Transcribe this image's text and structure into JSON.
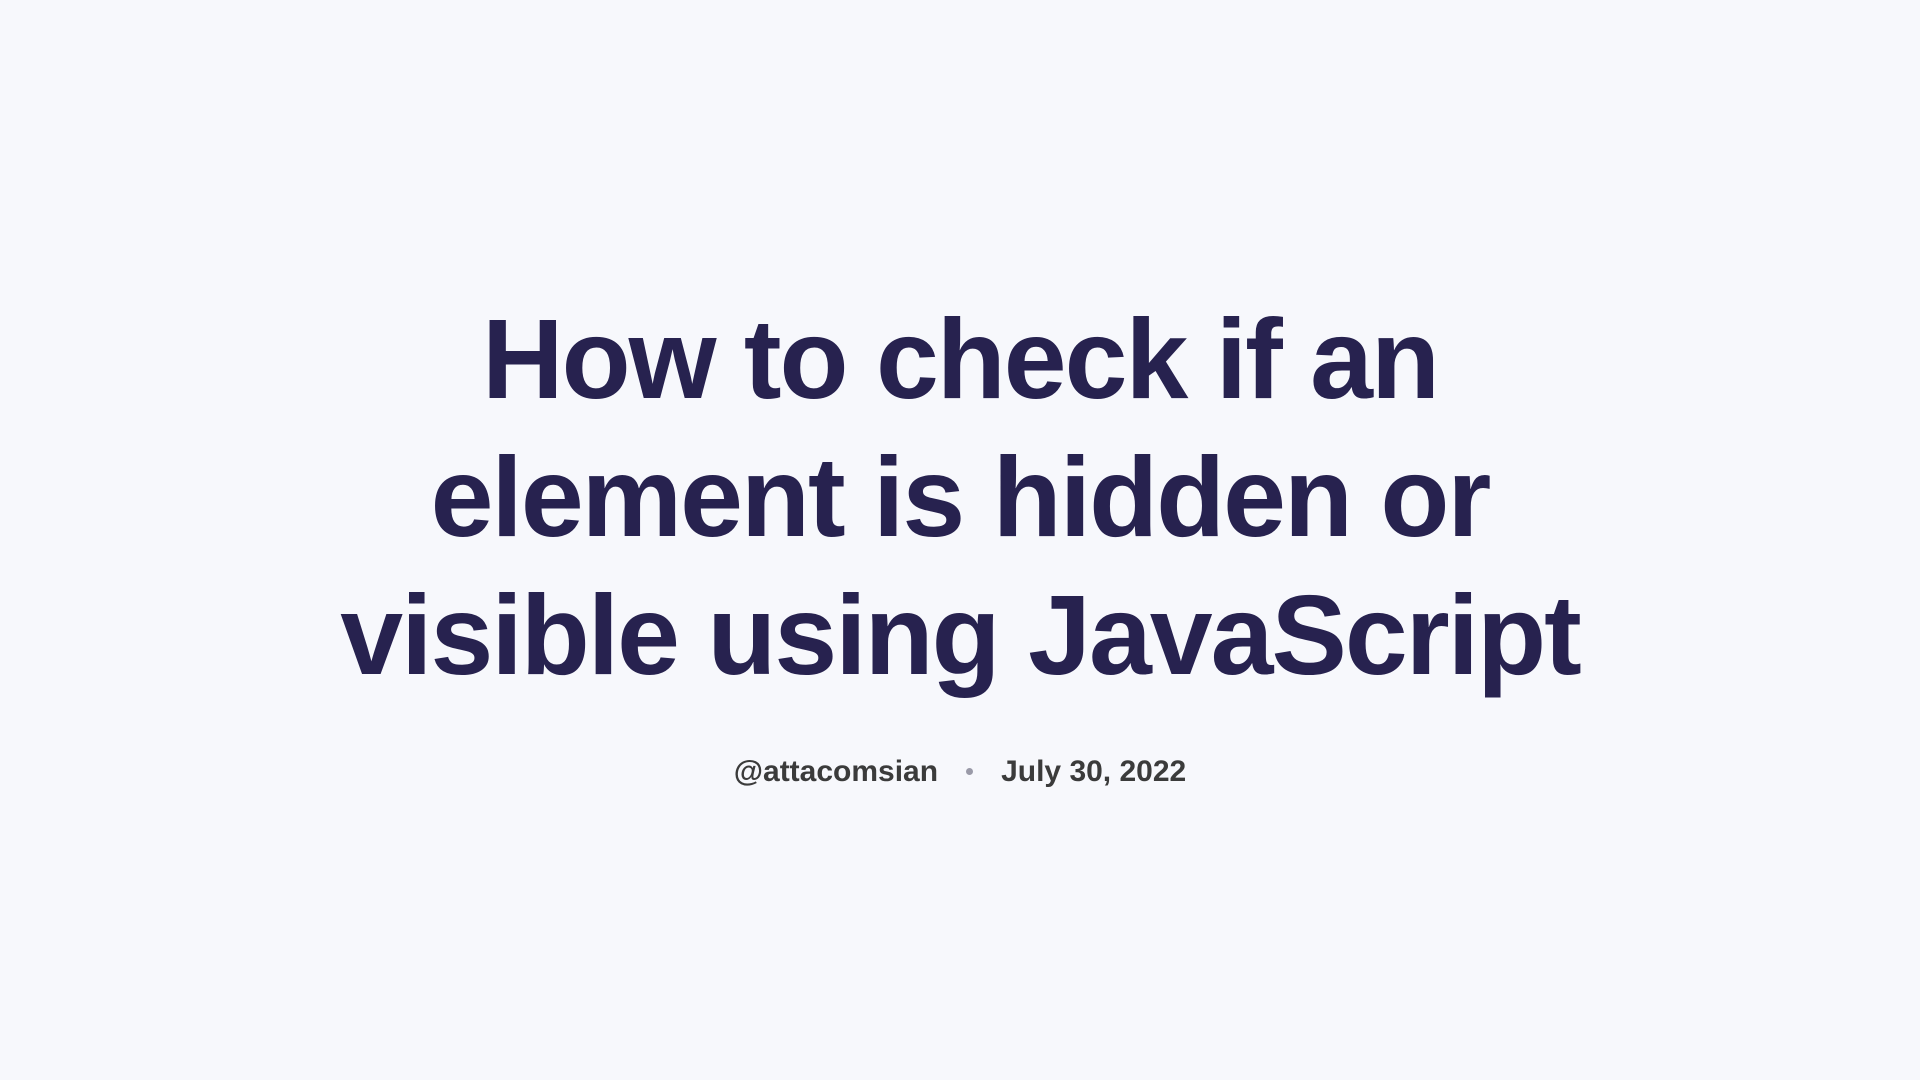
{
  "article": {
    "title": "How to check if an element is hidden or visible using JavaScript",
    "author": "@attacomsian",
    "date": "July 30, 2022"
  }
}
